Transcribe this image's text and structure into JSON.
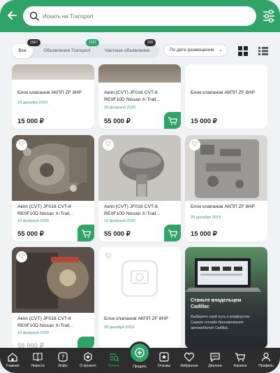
{
  "search": {
    "placeholder": "Искать на Transport"
  },
  "tabs": [
    {
      "label": "Все",
      "count": "1567"
    },
    {
      "label": "Объявления Transport",
      "count": "1237"
    },
    {
      "label": "Частные объявления",
      "count": "330"
    }
  ],
  "sort": {
    "label": "По дате размещения"
  },
  "cards": [
    {
      "title": "Блок клапанов АКПП ZF 8HP",
      "date": "29 декабря 2019",
      "price": "15 000 ₽"
    },
    {
      "title": "Акпп (CVT) JF016 CVT-8 RE0F10D Nissan X-Trail...",
      "date": "16 февраля 2020",
      "price": "55 000 ₽"
    },
    {
      "title": "Блок клапанов АКПП ZF 8HP",
      "date": "",
      "price": "15 000 ₽"
    },
    {
      "title": "Акпп (CVT) JF016 CVT-8 RE0F10D Nissan X-Trail...",
      "date": "16 февраля 2020",
      "price": "55 000 ₽"
    },
    {
      "title": "Акпп (CVT) JF016 CVT-8 RE0F10D Nissan X-Trail...",
      "date": "16 февраля 2020",
      "price": "55 000 ₽"
    },
    {
      "title": "Блок клапанов АКПП ZF 8HP",
      "date": "29 декабря 2019",
      "price": "15 000 ₽"
    },
    {
      "title": "Акпп (CVT) JF016 CVT-8 RE0F10D Nissan X-Trail...",
      "date": "16 февраля 2020",
      "price": "55 000 ₽"
    },
    {
      "title": "Блок клапанов АКПП ZF 8HP",
      "date": "29 декабря 2019",
      "price": ""
    }
  ],
  "promo": {
    "title": "Станьте владельцем Cadillac",
    "text": "Выберите свой путь к комфортом. Сервис онлайн-бронирования автомобилей Cadillac."
  },
  "nav": [
    {
      "label": "Главная",
      "icon": "home-icon"
    },
    {
      "label": "Новости",
      "icon": "news-icon"
    },
    {
      "label": "Инфо",
      "icon": "info-icon"
    },
    {
      "label": "О проекте",
      "icon": "about-icon"
    },
    {
      "label": "Купить",
      "icon": "buy-icon"
    },
    {
      "label": "Продать",
      "icon": "sell-icon"
    },
    {
      "label": "Отзывы",
      "icon": "reviews-icon"
    },
    {
      "label": "Избранное",
      "icon": "favorites-icon"
    },
    {
      "label": "Диалоги",
      "icon": "dialogs-icon"
    },
    {
      "label": "Корзина",
      "icon": "cart-icon"
    },
    {
      "label": "Профиль",
      "icon": "profile-icon"
    }
  ],
  "colors": {
    "accent": "#2fa368",
    "nav_bg": "#2d2d2d"
  }
}
